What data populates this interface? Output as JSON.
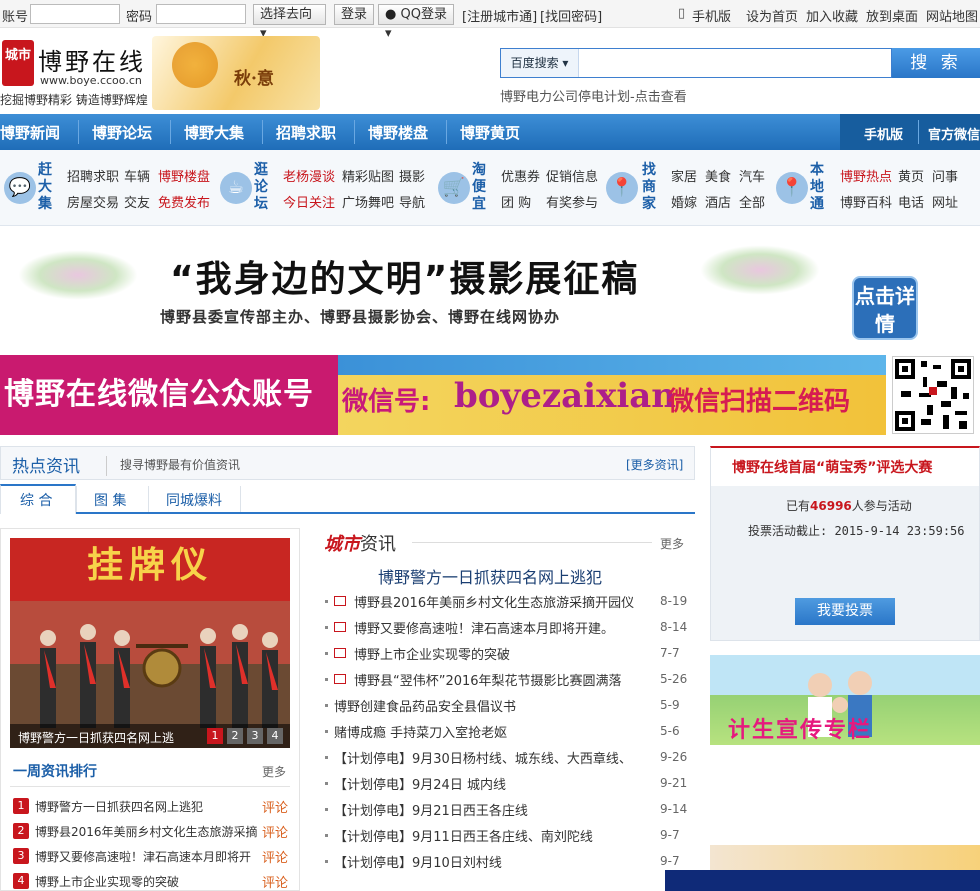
{
  "topbar": {
    "account_label": "账号",
    "password_label": "密码",
    "select_label": "选择去向",
    "login": "登录",
    "qq_login": "QQ登录",
    "register": "[注册城市通]",
    "forgot": "[找回密码]",
    "links": [
      "手机版",
      "设为首页",
      "加入收藏",
      "放到桌面",
      "网站地图"
    ]
  },
  "header": {
    "logo_mark": "城市",
    "logo_name": "博野在线",
    "logo_url": "www.boye.ccoo.cn",
    "slogan": "挖掘博野精彩 铸造博野辉煌",
    "autumn": "秋·意",
    "search_engine": "百度搜索",
    "search_button": "搜 索",
    "notice": "博野电力公司停电计划-点击查看"
  },
  "nav": {
    "items": [
      "博野新闻",
      "博野论坛",
      "博野大集",
      "招聘求职",
      "博野楼盘",
      "博野黄页"
    ],
    "right": [
      "手机版",
      "官方微信"
    ]
  },
  "channels": [
    {
      "head": "赶大集",
      "icon": "speech-bubble-icon",
      "rows": [
        [
          "招聘求职",
          "车辆",
          "博野楼盘"
        ],
        [
          "房屋交易",
          "交友",
          "免费发布"
        ]
      ],
      "red": [
        "博野楼盘",
        "免费发布"
      ]
    },
    {
      "head": "逛论坛",
      "icon": "coffee-cup-icon",
      "rows": [
        [
          "老杨漫谈",
          "精彩贴图",
          "摄影"
        ],
        [
          "今日关注",
          "广场舞吧",
          "导航"
        ]
      ],
      "red": [
        "老杨漫谈",
        "今日关注"
      ]
    },
    {
      "head": "淘便宜",
      "icon": "shopping-cart-icon",
      "rows": [
        [
          "优惠券",
          "促销信息"
        ],
        [
          "团  购",
          "有奖参与"
        ]
      ],
      "red": []
    },
    {
      "head": "找商家",
      "icon": "location-pin-icon",
      "rows": [
        [
          "家居",
          "美食",
          "汽车"
        ],
        [
          "婚嫁",
          "酒店",
          "全部"
        ]
      ],
      "red": []
    },
    {
      "head": "本地通",
      "icon": "location-pin-icon",
      "rows": [
        [
          "博野热点",
          "黄页",
          "问事"
        ],
        [
          "博野百科",
          "电话",
          "网址"
        ]
      ],
      "red": [
        "博野热点"
      ]
    }
  ],
  "banner1": {
    "title": "“我身边的文明”摄影展征稿",
    "subtitle": "博野县委宣传部主办、博野县摄影协会、博野在线网协办",
    "button": "点击详情"
  },
  "banner2": {
    "left": "博野在线微信公众账号",
    "wx_label": "微信号:",
    "wx_id": "boyezaixian",
    "scan": "微信扫描二维码"
  },
  "hot": {
    "title": "热点资讯",
    "subtitle": "搜寻博野最有价值资讯",
    "more": "[更多资讯]",
    "tabs": [
      "综  合",
      "图  集",
      "同城爆料"
    ]
  },
  "photo": {
    "banner_text": "挂牌仪",
    "caption": "博野警方一日抓获四名网上逃",
    "pages": [
      "1",
      "2",
      "3",
      "4"
    ]
  },
  "rank": {
    "title": "一周资讯排行",
    "more": "更多",
    "comment": "评论",
    "items": [
      "博野警方一日抓获四名网上逃犯",
      "博野县2016年美丽乡村文化生态旅游采摘",
      "博野又要修高速啦！津石高速本月即将开",
      "博野上市企业实现零的突破"
    ]
  },
  "city": {
    "title_a": "城市",
    "title_b": "资讯",
    "more": "更多",
    "headline": "博野警方一日抓获四名网上逃犯",
    "items": [
      {
        "text": "博野县2016年美丽乡村文化生态旅游采摘开园仪",
        "date": "8-19",
        "pic": true
      },
      {
        "text": "博野又要修高速啦！津石高速本月即将开建。",
        "date": "8-14",
        "pic": true
      },
      {
        "text": "博野上市企业实现零的突破",
        "date": "7-7",
        "pic": true
      },
      {
        "text": "博野县“翌伟杯”2016年梨花节摄影比赛圆满落",
        "date": "5-26",
        "pic": true
      },
      {
        "text": "博野创建食品药品安全县倡议书",
        "date": "5-9",
        "pic": false
      },
      {
        "text": "赌博成瘾 手持菜刀入室抢老妪",
        "date": "5-6",
        "pic": false
      },
      {
        "text": "【计划停电】9月30日杨村线、城东线、大西章线、",
        "date": "9-26",
        "pic": false
      },
      {
        "text": "【计划停电】9月24日  城内线",
        "date": "9-21",
        "pic": false
      },
      {
        "text": "【计划停电】9月21日西王各庄线",
        "date": "9-14",
        "pic": false
      },
      {
        "text": "【计划停电】9月11日西王各庄线、南刘陀线",
        "date": "9-7",
        "pic": false
      },
      {
        "text": "【计划停电】9月10日刘村线",
        "date": "9-7",
        "pic": false
      }
    ]
  },
  "vote": {
    "title": "博野在线首届“萌宝秀”评选大赛",
    "count_prefix": "已有",
    "count": "46996",
    "count_suffix": "人参与活动",
    "deadline": "投票活动截止: 2015-9-14 23:59:56",
    "button": "我要投票"
  },
  "family": {
    "text": "计生宣传专栏"
  },
  "colors": {
    "brand_red": "#c8161d",
    "nav_blue": "#2a76c8",
    "accent_pink": "#c91a6f"
  }
}
